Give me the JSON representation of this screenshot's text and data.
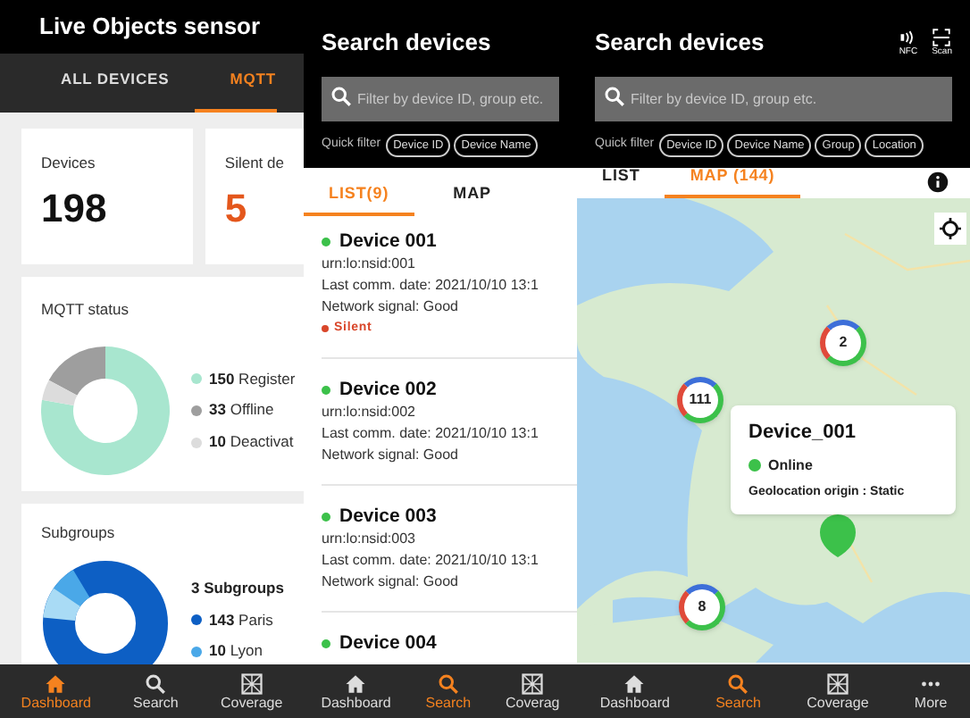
{
  "screens": [
    {
      "kind": "dashboard",
      "title": "Live Objects sensor",
      "tabs": [
        {
          "label": "ALL DEVICES",
          "selected": false
        },
        {
          "label": "MQTT",
          "selected": true
        }
      ],
      "stats": [
        {
          "label": "Devices",
          "value": "198",
          "alert": false
        },
        {
          "label": "Silent de",
          "value": "5",
          "alert": true
        }
      ],
      "mqtt_status": {
        "title": "MQTT status",
        "chart_data": {
          "type": "donut",
          "values": [
            77.72,
            17.1,
            5.18
          ]
        },
        "legend": [
          {
            "count": "150",
            "label": "Register",
            "color": "#a8e6cf"
          },
          {
            "count": "33",
            "label": "Offline",
            "color": "#9e9e9e"
          },
          {
            "count": "10",
            "label": "Deactivat",
            "color": "#dcdcdc"
          }
        ]
      },
      "subgroups": {
        "title": "Subgroups",
        "summary": "3 Subgroups",
        "legend": [
          {
            "count": "143",
            "label": "Paris",
            "color": "#0d5fc4"
          },
          {
            "count": "10",
            "label": "Lyon",
            "color": "#4aa8e8"
          }
        ]
      },
      "nav": [
        {
          "label": "Dashboard",
          "kind": "home",
          "selected": true
        },
        {
          "label": "Search",
          "kind": "search",
          "selected": false
        },
        {
          "label": "Coverage",
          "kind": "coverage",
          "selected": false
        }
      ]
    },
    {
      "kind": "list",
      "title": "Search devices",
      "search": {
        "placeholder": "Filter by device ID, group etc."
      },
      "quick_filter": {
        "label": "Quick filter",
        "chips": [
          "Device ID",
          "Device Name"
        ]
      },
      "tabs": [
        {
          "label": "LIST(9)",
          "selected": true
        },
        {
          "label": "MAP",
          "selected": false
        }
      ],
      "devices": [
        {
          "name": "Device 001",
          "color": "#3cc14a",
          "urn": "urn:lo:nsid:001",
          "last_comm": "Last comm. date: 2021/10/10 13:1",
          "signal": "Network signal: Good",
          "silent": "Silent"
        },
        {
          "name": "Device 002",
          "color": "#3cc14a",
          "urn": "urn:lo:nsid:002",
          "last_comm": "Last comm. date: 2021/10/10 13:1",
          "signal": "Network signal: Good"
        },
        {
          "name": "Device 003",
          "color": "#3cc14a",
          "urn": "urn:lo:nsid:003",
          "last_comm": "Last comm. date: 2021/10/10 13:1",
          "signal": "Network signal: Good"
        },
        {
          "name": "Device 004",
          "color": "#3cc14a"
        }
      ],
      "nav": [
        {
          "label": "Dashboard",
          "kind": "home",
          "selected": false
        },
        {
          "label": "Search",
          "kind": "search",
          "selected": true
        },
        {
          "label": "Coverag",
          "kind": "coverage",
          "selected": false
        }
      ]
    },
    {
      "kind": "map",
      "title": "Search devices",
      "actions": [
        {
          "label": "NFC",
          "kind": "nfc"
        },
        {
          "label": "Scan",
          "kind": "scan"
        }
      ],
      "search": {
        "placeholder": "Filter by device ID, group etc."
      },
      "quick_filter": {
        "label": "Quick filter",
        "chips": [
          "Device ID",
          "Device Name",
          "Group",
          "Location"
        ]
      },
      "tabs": [
        {
          "label": "LIST",
          "selected": false
        },
        {
          "label": "MAP (144)",
          "selected": true
        }
      ],
      "clusters": [
        {
          "count": "2"
        },
        {
          "count": "111"
        },
        {
          "count": "8"
        }
      ],
      "popup": {
        "title": "Device_001",
        "status": "Online",
        "origin": "Geolocation origin : Static"
      },
      "nav": [
        {
          "label": "Dashboard",
          "kind": "home",
          "selected": false
        },
        {
          "label": "Search",
          "kind": "search",
          "selected": true
        },
        {
          "label": "Coverage",
          "kind": "coverage",
          "selected": false
        },
        {
          "label": "More",
          "kind": "more",
          "selected": false
        }
      ]
    }
  ]
}
